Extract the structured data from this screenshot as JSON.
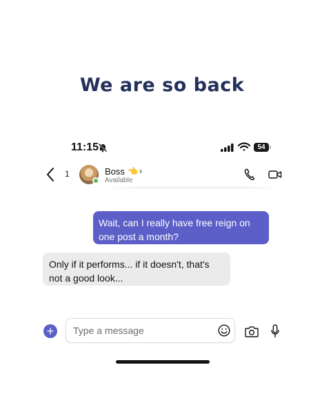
{
  "headline": "We are so back",
  "status_bar": {
    "time": "11:15",
    "battery": "54",
    "icons": [
      "bell-off-icon",
      "signal-icon",
      "wifi-icon",
      "battery-icon"
    ]
  },
  "chat_header": {
    "back_count": "1",
    "contact_name": "Boss",
    "name_emoji": "👈",
    "chevron": "›",
    "status": "Available",
    "presence_color": "#5cb85c"
  },
  "messages": [
    {
      "direction": "outgoing",
      "text": "Wait, can I really have free reign on one post a month?"
    },
    {
      "direction": "incoming",
      "text": "Only if it performs... if it doesn't, that's not a good look..."
    }
  ],
  "composer": {
    "placeholder": "Type a message",
    "plus_label": "+"
  },
  "colors": {
    "accent": "#5b5fc7",
    "headline": "#22305a",
    "incoming_bubble": "#ebebeb"
  }
}
